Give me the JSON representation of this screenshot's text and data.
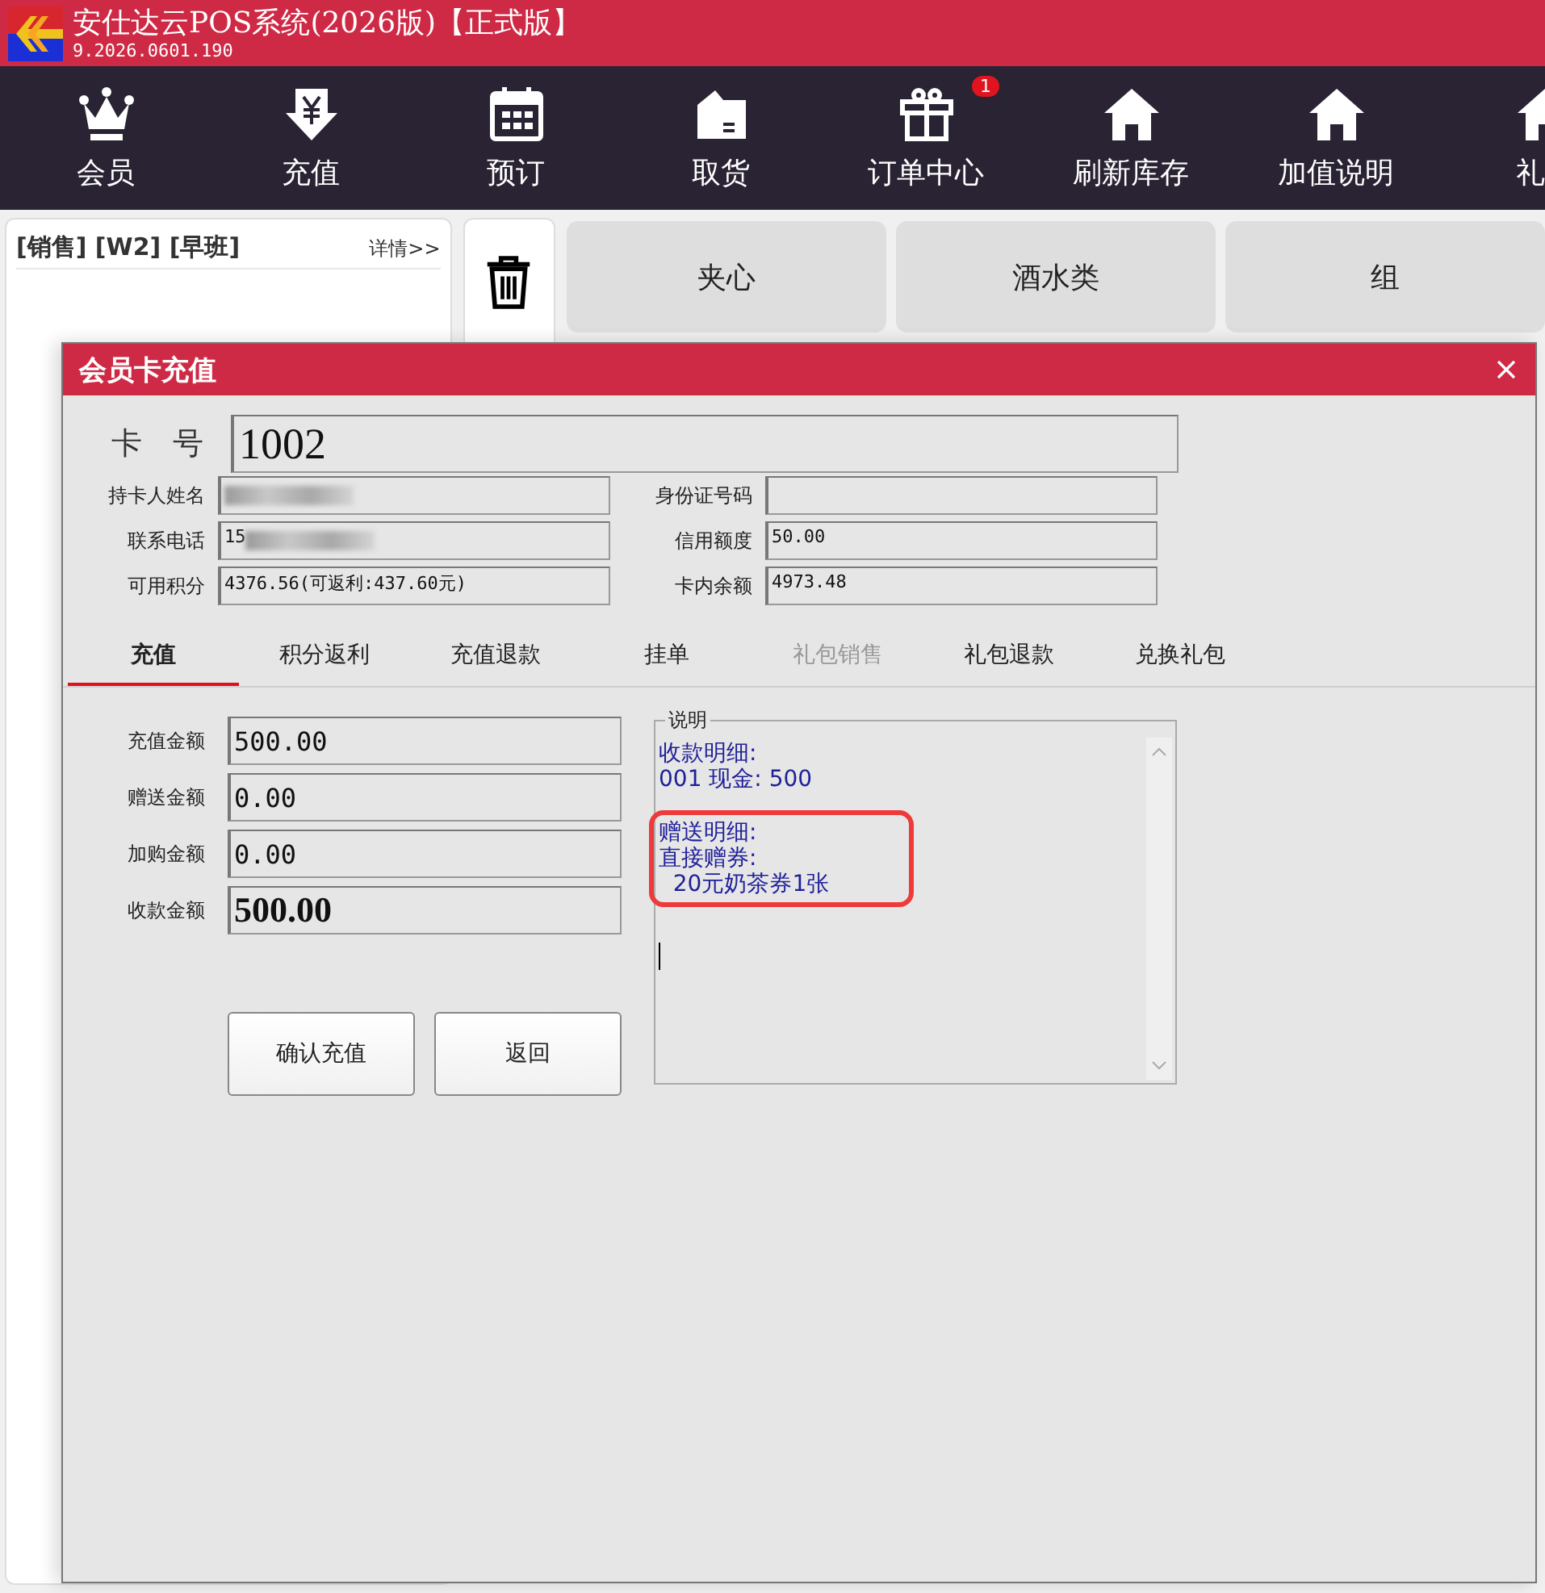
{
  "app": {
    "title": "安仕达云POS系统(2026版)【正式版】",
    "version": "9.2026.0601.190"
  },
  "nav": [
    {
      "label": "会员",
      "kind": "crown"
    },
    {
      "label": "充值",
      "kind": "yen"
    },
    {
      "label": "预订",
      "kind": "calendar"
    },
    {
      "label": "取货",
      "kind": "bag"
    },
    {
      "label": "订单中心",
      "kind": "gift",
      "badge": "1"
    },
    {
      "label": "刷新库存",
      "kind": "house"
    },
    {
      "label": "加值说明",
      "kind": "house"
    },
    {
      "label": "礼",
      "kind": "house"
    }
  ],
  "order_panel": {
    "header": "[销售] [W2] [早班]",
    "detail_link": "详情>>"
  },
  "categories": [
    "夹心",
    "酒水类",
    "组"
  ],
  "dialog": {
    "title": "会员卡充值",
    "card_label": "卡　号",
    "card_number": "1002",
    "info_fields": [
      {
        "label": "持卡人姓名",
        "redacted": true
      },
      {
        "label": "身份证号码"
      },
      {
        "label": "联系电话",
        "value": "15",
        "redacted": true
      },
      {
        "label": "信用额度",
        "value": "50.00"
      },
      {
        "label": "可用积分",
        "value": "4376.56(可返利:437.60元)"
      },
      {
        "label": "卡内余额",
        "value": "4973.48"
      }
    ],
    "tabs": [
      {
        "label": "充值",
        "selected": true,
        "disabled": false
      },
      {
        "label": "积分返利",
        "selected": false,
        "disabled": false
      },
      {
        "label": "充值退款",
        "selected": false,
        "disabled": false
      },
      {
        "label": "挂单",
        "selected": false,
        "disabled": false
      },
      {
        "label": "礼包销售",
        "selected": false,
        "disabled": true
      },
      {
        "label": "礼包退款",
        "selected": false,
        "disabled": false
      },
      {
        "label": "兑换礼包",
        "selected": false,
        "disabled": false
      }
    ],
    "amounts": [
      {
        "label": "充值金额",
        "value": "500.00",
        "emphasis": false
      },
      {
        "label": "赠送金额",
        "value": "0.00",
        "emphasis": false
      },
      {
        "label": "加购金额",
        "value": "0.00",
        "emphasis": false
      },
      {
        "label": "收款金额",
        "value": "500.00",
        "emphasis": true
      }
    ],
    "buttons": [
      "确认充值",
      "返回"
    ],
    "note": {
      "legend": "说明",
      "blocks": [
        {
          "lines": [
            "收款明细:",
            "001 现金: 500"
          ],
          "highlighted": false
        },
        {
          "lines": [
            "赠送明细:",
            "直接赠券:",
            "  20元奶茶券1张"
          ],
          "highlighted": true
        }
      ]
    }
  }
}
